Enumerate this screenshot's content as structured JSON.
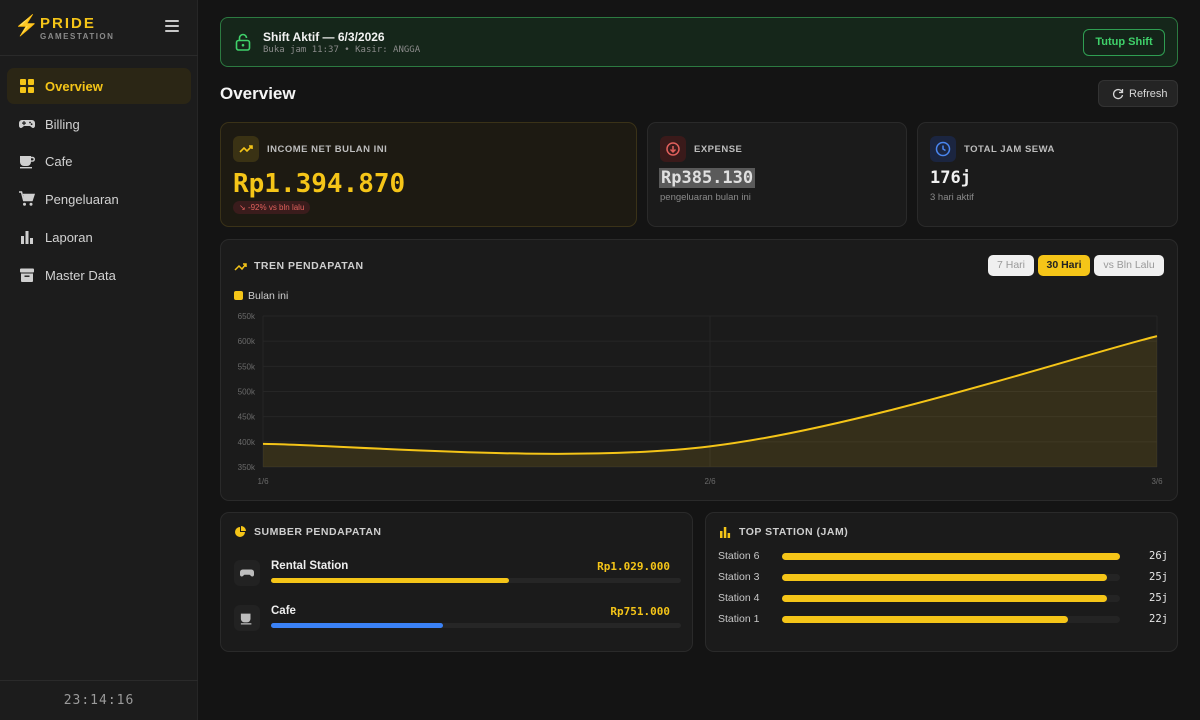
{
  "brand": {
    "name": "PRIDE",
    "sub": "GAMESTATION"
  },
  "nav": [
    {
      "label": "Overview",
      "icon": "grid-icon",
      "active": true
    },
    {
      "label": "Billing",
      "icon": "gamepad-icon"
    },
    {
      "label": "Cafe",
      "icon": "coffee-icon"
    },
    {
      "label": "Pengeluaran",
      "icon": "cart-icon"
    },
    {
      "label": "Laporan",
      "icon": "bar-chart-icon"
    },
    {
      "label": "Master Data",
      "icon": "archive-icon"
    }
  ],
  "clock": "23:14:16",
  "shift": {
    "title": "Shift Aktif — 6/3/2026",
    "detail": "Buka jam 11:37 • Kasir: ANGGA",
    "button": "Tutup Shift"
  },
  "page_title": "Overview",
  "refresh_label": "Refresh",
  "cards": {
    "income": {
      "title": "INCOME NET BULAN INI",
      "value": "Rp1.394.870",
      "delta": "-92% vs bln lalu"
    },
    "expense": {
      "title": "EXPENSE",
      "value": "Rp385.130",
      "note": "pengeluaran bulan ini"
    },
    "hours": {
      "title": "TOTAL JAM SEWA",
      "value": "176j",
      "note": "3 hari aktif"
    }
  },
  "trend": {
    "title": "TREN PENDAPATAN",
    "ranges": [
      "7 Hari",
      "30 Hari",
      "vs Bln Lalu"
    ],
    "active_range": "30 Hari",
    "legend": "Bulan ini"
  },
  "chart_data": {
    "type": "area",
    "x": [
      "1/6",
      "2/6",
      "3/6"
    ],
    "series": [
      {
        "name": "Bulan ini",
        "values": [
          396000,
          391000,
          610000
        ]
      }
    ],
    "y_ticks": [
      "350k",
      "400k",
      "450k",
      "500k",
      "550k",
      "600k",
      "650k"
    ],
    "ylim": [
      350000,
      650000
    ],
    "grid": true
  },
  "sources": {
    "title": "SUMBER PENDAPATAN",
    "items": [
      {
        "name": "Rental Station",
        "amount": "Rp1.029.000",
        "share": 0.58,
        "color": "#f5c518"
      },
      {
        "name": "Cafe",
        "amount": "Rp751.000",
        "share": 0.42,
        "color": "#3b82f6"
      }
    ]
  },
  "top": {
    "title": "TOP STATION (JAM)",
    "items": [
      {
        "name": "Station 6",
        "hours": "26j",
        "value": 26
      },
      {
        "name": "Station 3",
        "hours": "25j",
        "value": 25
      },
      {
        "name": "Station 4",
        "hours": "25j",
        "value": 25
      },
      {
        "name": "Station 1",
        "hours": "22j",
        "value": 22
      }
    ],
    "max": 26
  }
}
